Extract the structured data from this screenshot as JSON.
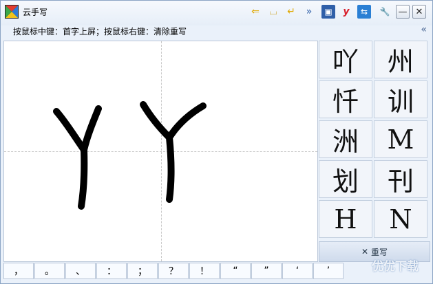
{
  "window": {
    "title": "云手写"
  },
  "hint": "按鼠标中键：首字上屏；按鼠标右键：清除重写",
  "toolbar": {
    "back": "⇐",
    "space": "⌴",
    "enter": "↵",
    "more": "»",
    "pin": "▣",
    "y_label": "y",
    "swap": "⇆",
    "settings": "🔧"
  },
  "window_buttons": {
    "minimize": "—",
    "close": "✕"
  },
  "collapse": "«",
  "candidates": [
    "吖",
    "州",
    "忏",
    "训",
    "洲",
    "M",
    "划",
    "刊",
    "H",
    "N"
  ],
  "rewrite": {
    "icon": "✕",
    "label": "重写"
  },
  "punctuation": [
    "，",
    "。",
    "、",
    "：",
    "；",
    "？",
    "！",
    "“",
    "”",
    "‘",
    "’"
  ],
  "watermark": "优优下载",
  "colors": {
    "accent": "#4d6a96",
    "ink": "#000000"
  }
}
